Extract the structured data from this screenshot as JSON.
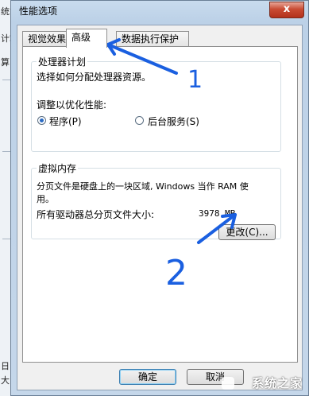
{
  "background_window": {
    "fragments": [
      "统能",
      "计算",
      "算",
      "日",
      "大"
    ]
  },
  "window": {
    "title": "性能选项",
    "close_label": "x"
  },
  "tabs": [
    {
      "label": "视觉效果",
      "active": false
    },
    {
      "label": "高级",
      "active": true
    },
    {
      "label": "数据执行保护",
      "active": false
    }
  ],
  "processor": {
    "heading": "处理器计划",
    "description": "选择如何分配处理器资源。",
    "adjust_label": "调整以优化性能:",
    "options": [
      {
        "label": "程序(P)",
        "selected": true
      },
      {
        "label": "后台服务(S)",
        "selected": false
      }
    ]
  },
  "virtual_memory": {
    "legend": "虚拟内存",
    "description_line1": "分页文件是硬盘上的一块区域, Windows 当作 RAM 使",
    "description_line2": "用。",
    "total_label": "所有驱动器总分页文件大小:",
    "total_value": "3978 MB",
    "change_button": "更改(C)..."
  },
  "footer": {
    "ok_button": "确定",
    "cancel_button": "取消"
  },
  "annotations": {
    "label_1": "1",
    "label_2": "2",
    "color": "#1a5fe0"
  },
  "watermark": "系统之家"
}
